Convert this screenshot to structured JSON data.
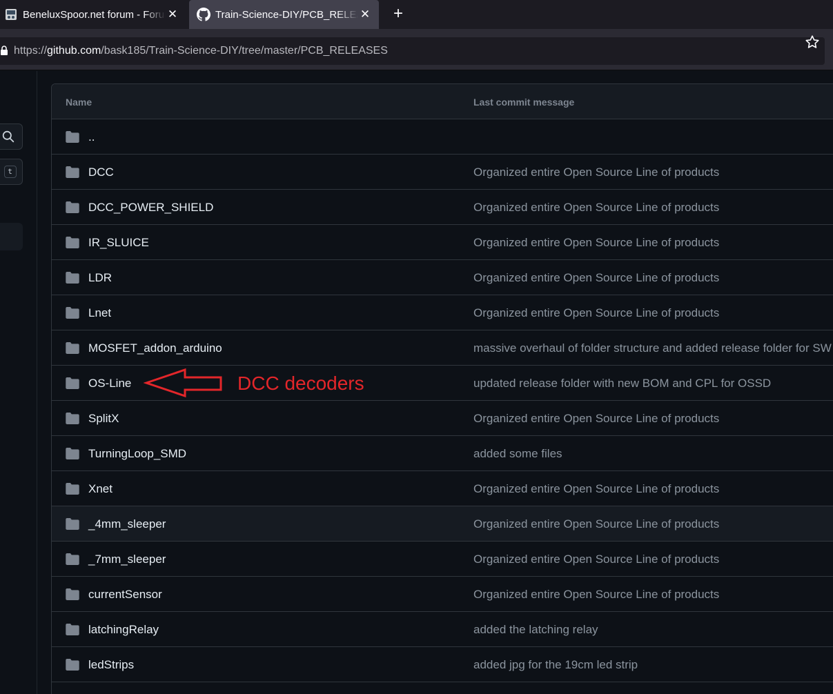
{
  "browser": {
    "tabs": [
      {
        "title": "BeneluxSpoor.net forum - Forum",
        "active": false
      },
      {
        "title": "Train-Science-DIY/PCB_RELEASES",
        "active": true
      }
    ],
    "new_tab_label": "+",
    "close_label": "✕",
    "url": {
      "scheme": "https://",
      "host": "github.com",
      "path": "/bask185/Train-Science-DIY/tree/master/PCB_RELEASES"
    }
  },
  "sidebar": {
    "shortcut_key": "t"
  },
  "table": {
    "headers": {
      "name": "Name",
      "message": "Last commit message"
    },
    "rows": [
      {
        "name": "..",
        "message": ""
      },
      {
        "name": "DCC",
        "message": "Organized entire Open Source Line of products"
      },
      {
        "name": "DCC_POWER_SHIELD",
        "message": "Organized entire Open Source Line of products"
      },
      {
        "name": "IR_SLUICE",
        "message": "Organized entire Open Source Line of products"
      },
      {
        "name": "LDR",
        "message": "Organized entire Open Source Line of products"
      },
      {
        "name": "Lnet",
        "message": "Organized entire Open Source Line of products"
      },
      {
        "name": "MOSFET_addon_arduino",
        "message": "massive overhaul of folder structure and added release folder for SW"
      },
      {
        "name": "OS-Line",
        "message": "updated release folder with new BOM and CPL for OSSD"
      },
      {
        "name": "SplitX",
        "message": "Organized entire Open Source Line of products"
      },
      {
        "name": "TurningLoop_SMD",
        "message": "added some files"
      },
      {
        "name": "Xnet",
        "message": "Organized entire Open Source Line of products"
      },
      {
        "name": "_4mm_sleeper",
        "message": "Organized entire Open Source Line of products"
      },
      {
        "name": "_7mm_sleeper",
        "message": "Organized entire Open Source Line of products"
      },
      {
        "name": "currentSensor",
        "message": "Organized entire Open Source Line of products"
      },
      {
        "name": "latchingRelay",
        "message": "added the latching relay"
      },
      {
        "name": "ledStrips",
        "message": "added jpg for the 19cm led strip"
      },
      {
        "name": "",
        "message": ""
      }
    ]
  },
  "annotation": {
    "text": "DCC decoders",
    "color": "#e3262a"
  },
  "colors": {
    "page_bg": "#0d1117",
    "border": "#30363d",
    "folder": "#7d8590",
    "muted_text": "#8b949e"
  }
}
